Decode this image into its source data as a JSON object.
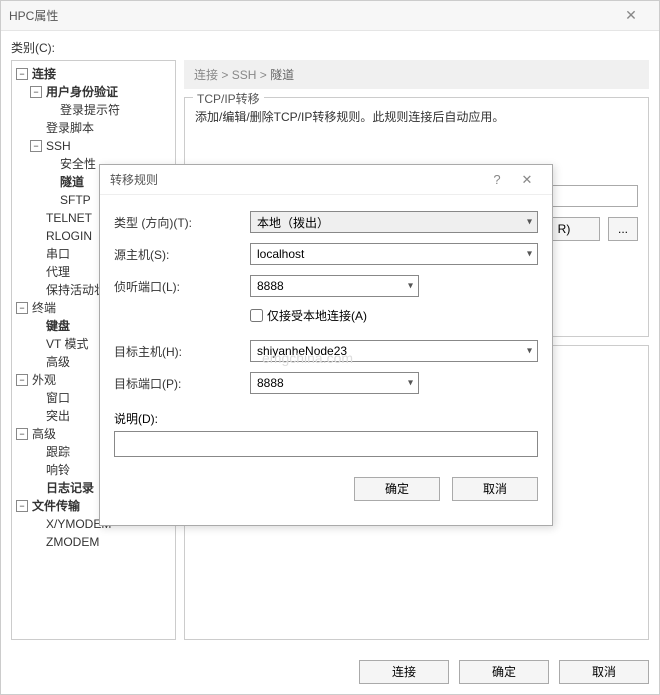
{
  "main": {
    "title": "HPC属性",
    "category_label": "类别(C):",
    "breadcrumb": [
      "连接",
      "SSH",
      "隧道"
    ],
    "group_title": "TCP/IP转移",
    "description": "添加/编辑/删除TCP/IP转移规则。此规则连接后自动应用。",
    "btn_r": "R)",
    "btn_more": "...",
    "buttons": {
      "connect": "连接",
      "ok": "确定",
      "cancel": "取消"
    }
  },
  "tree": {
    "items": [
      {
        "label": "连接",
        "bold": true,
        "exp": "-",
        "children": [
          {
            "label": "用户身份验证",
            "bold": true,
            "exp": "-",
            "children": [
              {
                "label": "登录提示符",
                "bold": false
              }
            ]
          },
          {
            "label": "登录脚本",
            "bold": false
          },
          {
            "label": "SSH",
            "bold": false,
            "exp": "-",
            "children": [
              {
                "label": "安全性",
                "bold": false
              },
              {
                "label": "隧道",
                "bold": true
              },
              {
                "label": "SFTP",
                "bold": false
              }
            ]
          },
          {
            "label": "TELNET",
            "bold": false
          },
          {
            "label": "RLOGIN",
            "bold": false
          },
          {
            "label": "串口",
            "bold": false
          },
          {
            "label": "代理",
            "bold": false
          },
          {
            "label": "保持活动状态",
            "bold": false
          }
        ]
      },
      {
        "label": "终端",
        "bold": false,
        "exp": "-",
        "children": [
          {
            "label": "键盘",
            "bold": true
          },
          {
            "label": "VT 模式",
            "bold": false
          },
          {
            "label": "高级",
            "bold": false
          }
        ]
      },
      {
        "label": "外观",
        "bold": false,
        "exp": "-",
        "children": [
          {
            "label": "窗口",
            "bold": false
          },
          {
            "label": "突出",
            "bold": false
          }
        ]
      },
      {
        "label": "高级",
        "bold": false,
        "exp": "-",
        "children": [
          {
            "label": "跟踪",
            "bold": false
          },
          {
            "label": "响铃",
            "bold": false
          },
          {
            "label": "日志记录",
            "bold": true
          }
        ]
      },
      {
        "label": "文件传输",
        "bold": true,
        "exp": "-",
        "children": [
          {
            "label": "X/YMODEM",
            "bold": false
          },
          {
            "label": "ZMODEM",
            "bold": false
          }
        ]
      }
    ]
  },
  "modal": {
    "title": "转移规则",
    "labels": {
      "type": "类型 (方向)(T):",
      "source_host": "源主机(S):",
      "listen_port": "侦听端口(L):",
      "local_only": "仅接受本地连接(A)",
      "dest_host": "目标主机(H):",
      "dest_port": "目标端口(P):",
      "description": "说明(D):"
    },
    "values": {
      "type": "本地（拨出）",
      "source_host": "localhost",
      "listen_port": "8888",
      "local_only_checked": false,
      "dest_host": "shiyanheNode23",
      "dest_port": "8888",
      "description": ""
    },
    "buttons": {
      "ok": "确定",
      "cancel": "取消"
    }
  },
  "watermark": "emgchina.com"
}
